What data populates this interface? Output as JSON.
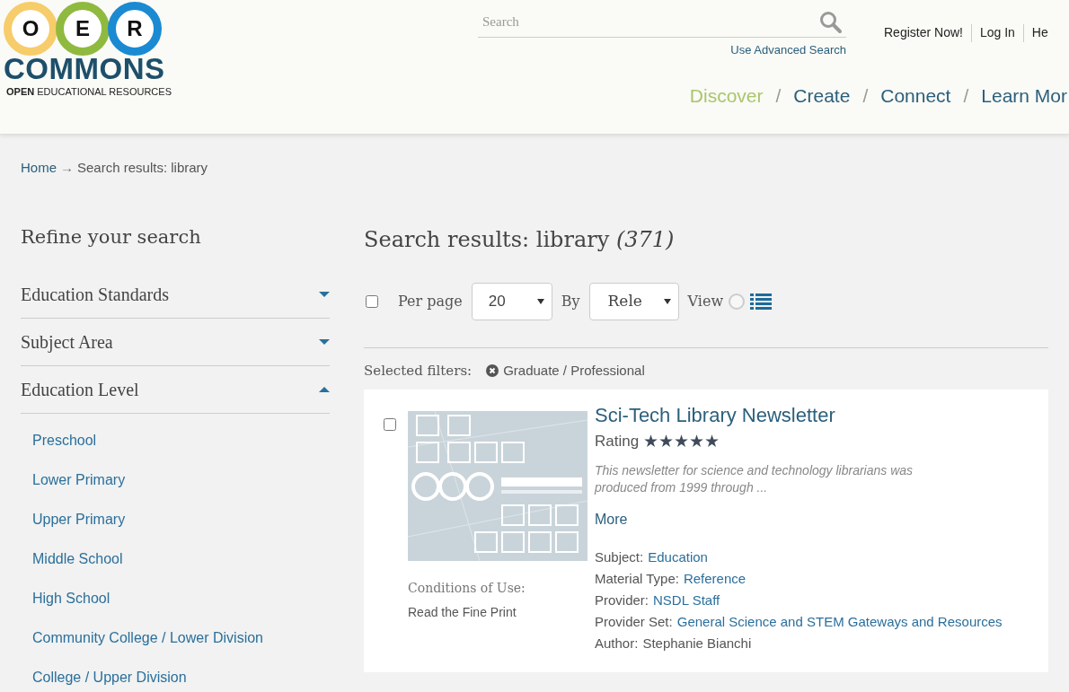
{
  "logo": {
    "letters": [
      "O",
      "E",
      "R"
    ],
    "name": "COMMONS",
    "tagline_bold": "OPEN",
    "tagline": "EDUCATIONAL RESOURCES"
  },
  "search": {
    "placeholder": "Search",
    "advanced_link": "Use Advanced Search"
  },
  "account_links": [
    "Register Now!",
    "Log In",
    "He"
  ],
  "nav_separator": "/",
  "main_nav": [
    {
      "label": "Discover",
      "selected": true
    },
    {
      "label": "Create",
      "selected": false
    },
    {
      "label": "Connect",
      "selected": false
    },
    {
      "label": "Learn Mor",
      "selected": false
    }
  ],
  "breadcrumb": {
    "home": "Home",
    "arrow": "→",
    "current": "Search results: library"
  },
  "sidebar": {
    "title": "Refine your search",
    "facets": [
      {
        "label": "Education Standards",
        "expanded": false
      },
      {
        "label": "Subject Area",
        "expanded": false
      },
      {
        "label": "Education Level",
        "expanded": true,
        "children": [
          "Preschool",
          "Lower Primary",
          "Upper Primary",
          "Middle School",
          "High School",
          "Community College / Lower Division",
          "College / Upper Division"
        ]
      }
    ]
  },
  "results_heading": {
    "title": "Search results: library",
    "count": "(371)"
  },
  "toolbar": {
    "select_all_checked": false,
    "per_page_label": "Per page",
    "per_page": "20",
    "by_label": "By",
    "sort": "Rele",
    "view_label": "View",
    "view_options": [
      {
        "kind": "radio",
        "selected": false
      },
      {
        "kind": "list",
        "selected": true
      }
    ]
  },
  "filters": {
    "label": "Selected filters:",
    "items": [
      "Graduate / Professional"
    ]
  },
  "results": [
    {
      "checked": false,
      "conditions_label": "Conditions of Use:",
      "conditions_value": "Read the Fine Print",
      "title": "Sci-Tech Library Newsletter",
      "rating_label": "Rating",
      "stars": 5,
      "description": "This newsletter for science and technology librarians was produced from 1999 through ...",
      "more": "More",
      "fields": [
        {
          "label": "Subject:",
          "value": "Education",
          "link": true
        },
        {
          "label": "Material Type:",
          "value": "Reference",
          "link": true
        },
        {
          "label": "Provider:",
          "value": "NSDL Staff",
          "link": true
        },
        {
          "label": "Provider Set:",
          "value": "General Science and STEM Gateways and Resources",
          "link": true
        },
        {
          "label": "Author:",
          "value": "Stephanie Bianchi",
          "link": false
        }
      ]
    }
  ]
}
